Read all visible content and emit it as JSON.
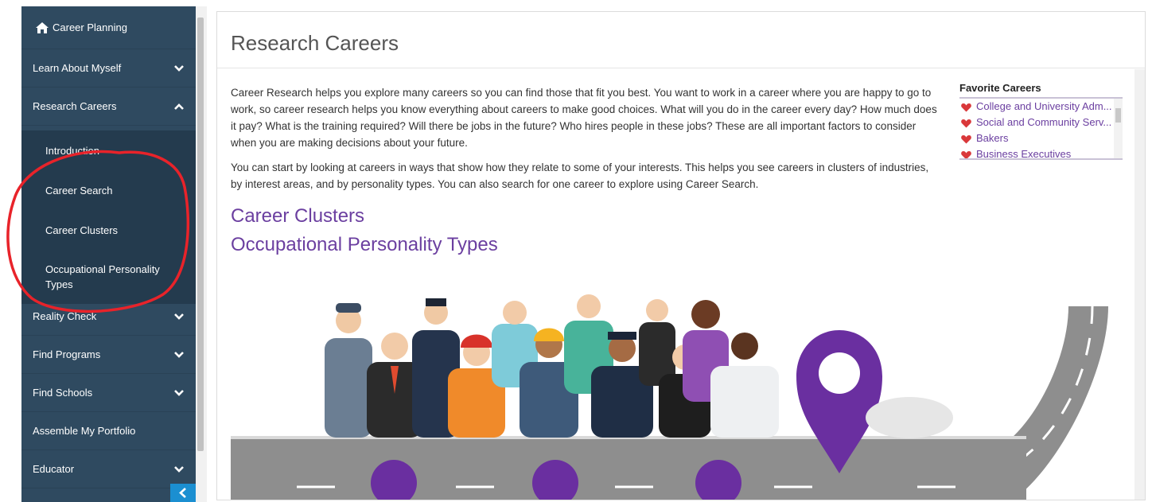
{
  "sidebar": {
    "home_label": "Career Planning",
    "items": [
      {
        "label": "Learn About Myself"
      },
      {
        "label": "Research Careers"
      },
      {
        "label": "Reality Check"
      },
      {
        "label": "Find Programs"
      },
      {
        "label": "Find Schools"
      },
      {
        "label": "Assemble My Portfolio"
      },
      {
        "label": "Educator"
      }
    ],
    "sub_items": [
      {
        "label": "Introduction"
      },
      {
        "label": "Career Search"
      },
      {
        "label": "Career Clusters"
      },
      {
        "label": "Occupational Personality Types"
      }
    ]
  },
  "main": {
    "title": "Research Careers",
    "paragraph1": "Career Research helps you explore many careers so you can find those that fit you best. You want to work in a career where you are happy to go to work, so career research helps you know everything about careers to make good choices. What will you do in the career every day? How much does it pay? What is the training required? Will there be jobs in the future? Who hires people in these jobs? These are all important factors to consider when you are making decisions about your future.",
    "paragraph2": "You can start by looking at careers in ways that show how they relate to some of your interests. This helps you see careers in clusters of industries, by interest areas, and by personality types. You can also search for one career to explore using Career Search.",
    "link_clusters": "Career Clusters",
    "link_personality": "Occupational Personality Types"
  },
  "favorites": {
    "title": "Favorite Careers",
    "items": [
      {
        "label": "College and University Adm..."
      },
      {
        "label": "Social and Community Serv..."
      },
      {
        "label": "Bakers"
      },
      {
        "label": "Business Executives"
      }
    ]
  },
  "colors": {
    "sidebar_bg": "#2f4a60",
    "submenu_bg": "#243b4e",
    "accent_purple": "#6b3fa0",
    "heart_red": "#d9383a",
    "collapse_blue": "#1b8fd1",
    "annotation_red": "#e8232a"
  },
  "icons": [
    "home-icon",
    "chevron-down-icon",
    "chevron-up-icon",
    "heart-icon",
    "chevron-left-icon",
    "location-pin-icon"
  ]
}
